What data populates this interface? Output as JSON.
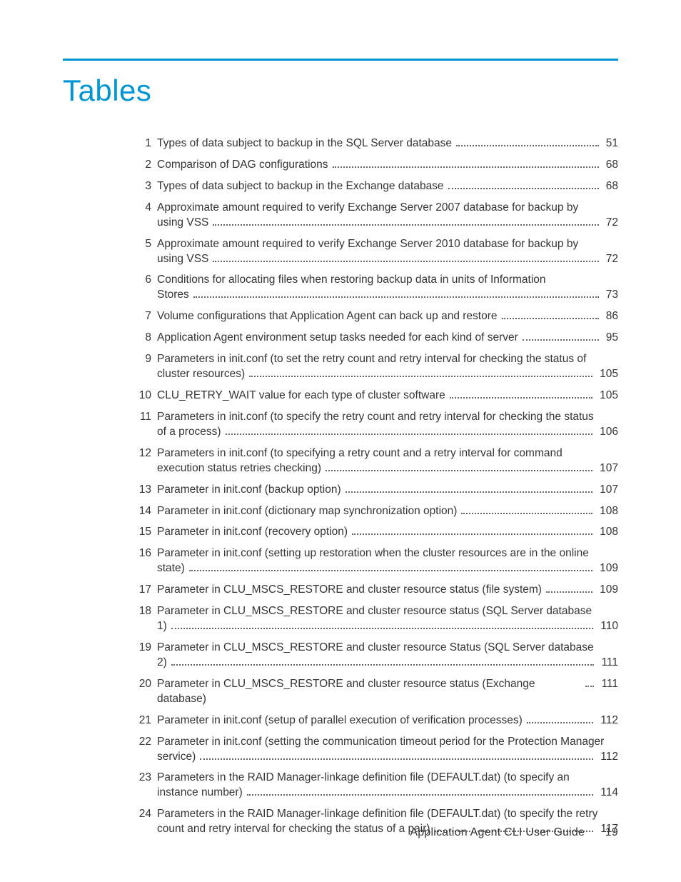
{
  "heading": "Tables",
  "footer": {
    "label": "Application Agent CLI User Guide",
    "page": "19"
  },
  "entries": [
    {
      "n": "1",
      "pre": null,
      "tail": "Types of data subject to backup in the SQL Server database",
      "page": "51"
    },
    {
      "n": "2",
      "pre": null,
      "tail": "Comparison of DAG configurations",
      "page": "68"
    },
    {
      "n": "3",
      "pre": null,
      "tail": "Types of data subject to backup in the Exchange database",
      "page": "68"
    },
    {
      "n": "4",
      "pre": "Approximate amount required to verify Exchange Server 2007 database for backup by",
      "tail": "using VSS",
      "page": "72"
    },
    {
      "n": "5",
      "pre": "Approximate amount required to verify Exchange Server 2010 database for backup by",
      "tail": "using VSS",
      "page": "72"
    },
    {
      "n": "6",
      "pre": "Conditions for allocating files when restoring backup data in units of Information",
      "tail": "Stores",
      "page": "73"
    },
    {
      "n": "7",
      "pre": null,
      "tail": "Volume configurations that Application Agent can back up and restore",
      "page": "86"
    },
    {
      "n": "8",
      "pre": null,
      "tail": "Application Agent environment setup tasks needed for each kind of server",
      "page": "95"
    },
    {
      "n": "9",
      "pre": "Parameters in init.conf (to set the retry count and retry interval for checking the status of",
      "tail": "cluster resources)",
      "page": "105"
    },
    {
      "n": "10",
      "pre": null,
      "tail": "CLU_RETRY_WAIT value for each type of cluster software",
      "page": "105"
    },
    {
      "n": "11",
      "pre": "Parameters in init.conf (to specify the retry count and retry interval for checking the status",
      "tail": "of a process)",
      "page": "106"
    },
    {
      "n": "12",
      "pre": "Parameters in init.conf (to specifying a retry count and a retry interval for command",
      "tail": "execution status retries checking)",
      "page": "107"
    },
    {
      "n": "13",
      "pre": null,
      "tail": "Parameter in init.conf (backup option)",
      "page": "107"
    },
    {
      "n": "14",
      "pre": null,
      "tail": "Parameter in init.conf (dictionary map synchronization option)",
      "page": "108"
    },
    {
      "n": "15",
      "pre": null,
      "tail": "Parameter in init.conf (recovery option)",
      "page": "108"
    },
    {
      "n": "16",
      "pre": "Parameter in init.conf (setting up restoration when the cluster resources are in the online",
      "tail": "state)",
      "page": "109"
    },
    {
      "n": "17",
      "pre": null,
      "tail": "Parameter in CLU_MSCS_RESTORE and cluster resource status (file system)",
      "page": "109"
    },
    {
      "n": "18",
      "pre": "Parameter in CLU_MSCS_RESTORE and cluster resource status (SQL Server database",
      "tail": "1)",
      "page": "110"
    },
    {
      "n": "19",
      "pre": "Parameter in CLU_MSCS_RESTORE and cluster resource Status (SQL Server database",
      "tail": "2)",
      "page": "111"
    },
    {
      "n": "20",
      "pre": null,
      "tail": "Parameter in CLU_MSCS_RESTORE and cluster resource status (Exchange database)",
      "page": "111"
    },
    {
      "n": "21",
      "pre": null,
      "tail": "Parameter in init.conf (setup of parallel execution of verification processes)",
      "page": "112"
    },
    {
      "n": "22",
      "pre": "Parameter in init.conf (setting the communication timeout period for the Protection Manager",
      "tail": "service)",
      "page": "112"
    },
    {
      "n": "23",
      "pre": "Parameters in the RAID Manager-linkage definition file (DEFAULT.dat) (to specify an",
      "tail": "instance number)",
      "page": "114"
    },
    {
      "n": "24",
      "pre": "Parameters in the RAID Manager-linkage definition file (DEFAULT.dat) (to specify the retry",
      "tail": "count and retry interval for checking the status of a pair)",
      "page": "117"
    }
  ]
}
